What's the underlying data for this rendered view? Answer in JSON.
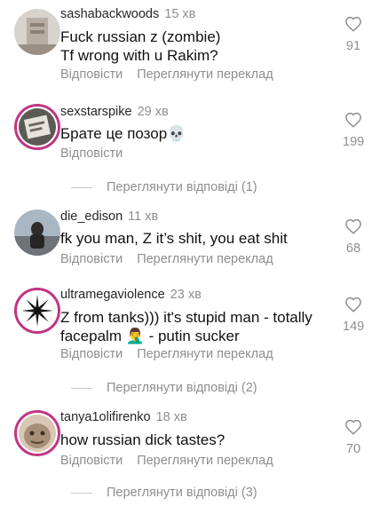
{
  "comments": [
    {
      "username": "sashabackwoods",
      "time": "15 хв",
      "lines": [
        "Fuck russian z (zombie)",
        "Tf wrong with u Rakim?"
      ],
      "likes": "91",
      "reply_label": "Відповісти",
      "translate_label": "Переглянути переклад"
    },
    {
      "username": "sexstarspike",
      "time": "29 хв",
      "lines": [
        "Брате це позор💀"
      ],
      "likes": "199",
      "reply_label": "Відповісти",
      "view_replies": "Переглянути відповіді (1)"
    },
    {
      "username": "die_edison",
      "time": "11 хв",
      "lines": [
        "fk you man, Z it’s shit, you eat shit"
      ],
      "likes": "68",
      "reply_label": "Відповісти",
      "translate_label": "Переглянути переклад"
    },
    {
      "username": "ultramegaviolence",
      "time": "23 хв",
      "lines": [
        "Z from tanks))) it's stupid man - totally",
        "facepalm 🤦‍♂️ - putin sucker"
      ],
      "likes": "149",
      "reply_label": "Відповісти",
      "translate_label": "Переглянути переклад",
      "view_replies": "Переглянути відповіді (2)"
    },
    {
      "username": "tanya1olifirenko",
      "time": "18 хв",
      "lines": [
        "how russian dick tastes?"
      ],
      "likes": "70",
      "reply_label": "Відповісти",
      "translate_label": "Переглянути переклад",
      "view_replies": "Переглянути відповіді (3)"
    }
  ],
  "icons": {
    "like": "heart-outline-icon"
  },
  "colors": {
    "story_ring": "#c13584",
    "secondary_text": "#8e8e8e"
  }
}
